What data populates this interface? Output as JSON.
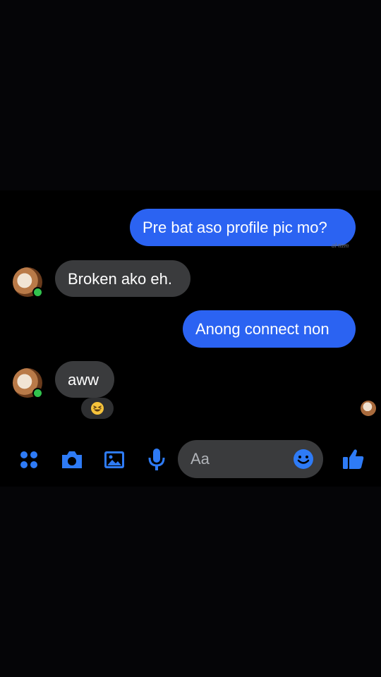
{
  "conversation": {
    "messages": [
      {
        "direction": "outgoing",
        "text": "Pre bat aso profile pic mo?"
      },
      {
        "direction": "incoming",
        "text": "Broken ako eh."
      },
      {
        "direction": "outgoing",
        "text": "Anong connect non"
      },
      {
        "direction": "incoming",
        "text": "aww"
      }
    ],
    "reaction": {
      "emoji": "laughing-face-icon"
    },
    "watermark": "a̶l̶ ̶t̶i̶z̶m"
  },
  "composer": {
    "placeholder": "Aa"
  },
  "toolbar": {
    "icons": [
      "apps-icon",
      "camera-icon",
      "gallery-icon",
      "microphone-icon",
      "emoji-icon",
      "thumbs-up-icon"
    ]
  },
  "colors": {
    "accent": "#2b63f2",
    "incoming_bubble": "#3a3b3d",
    "online": "#31c24d",
    "background": "#000000"
  }
}
